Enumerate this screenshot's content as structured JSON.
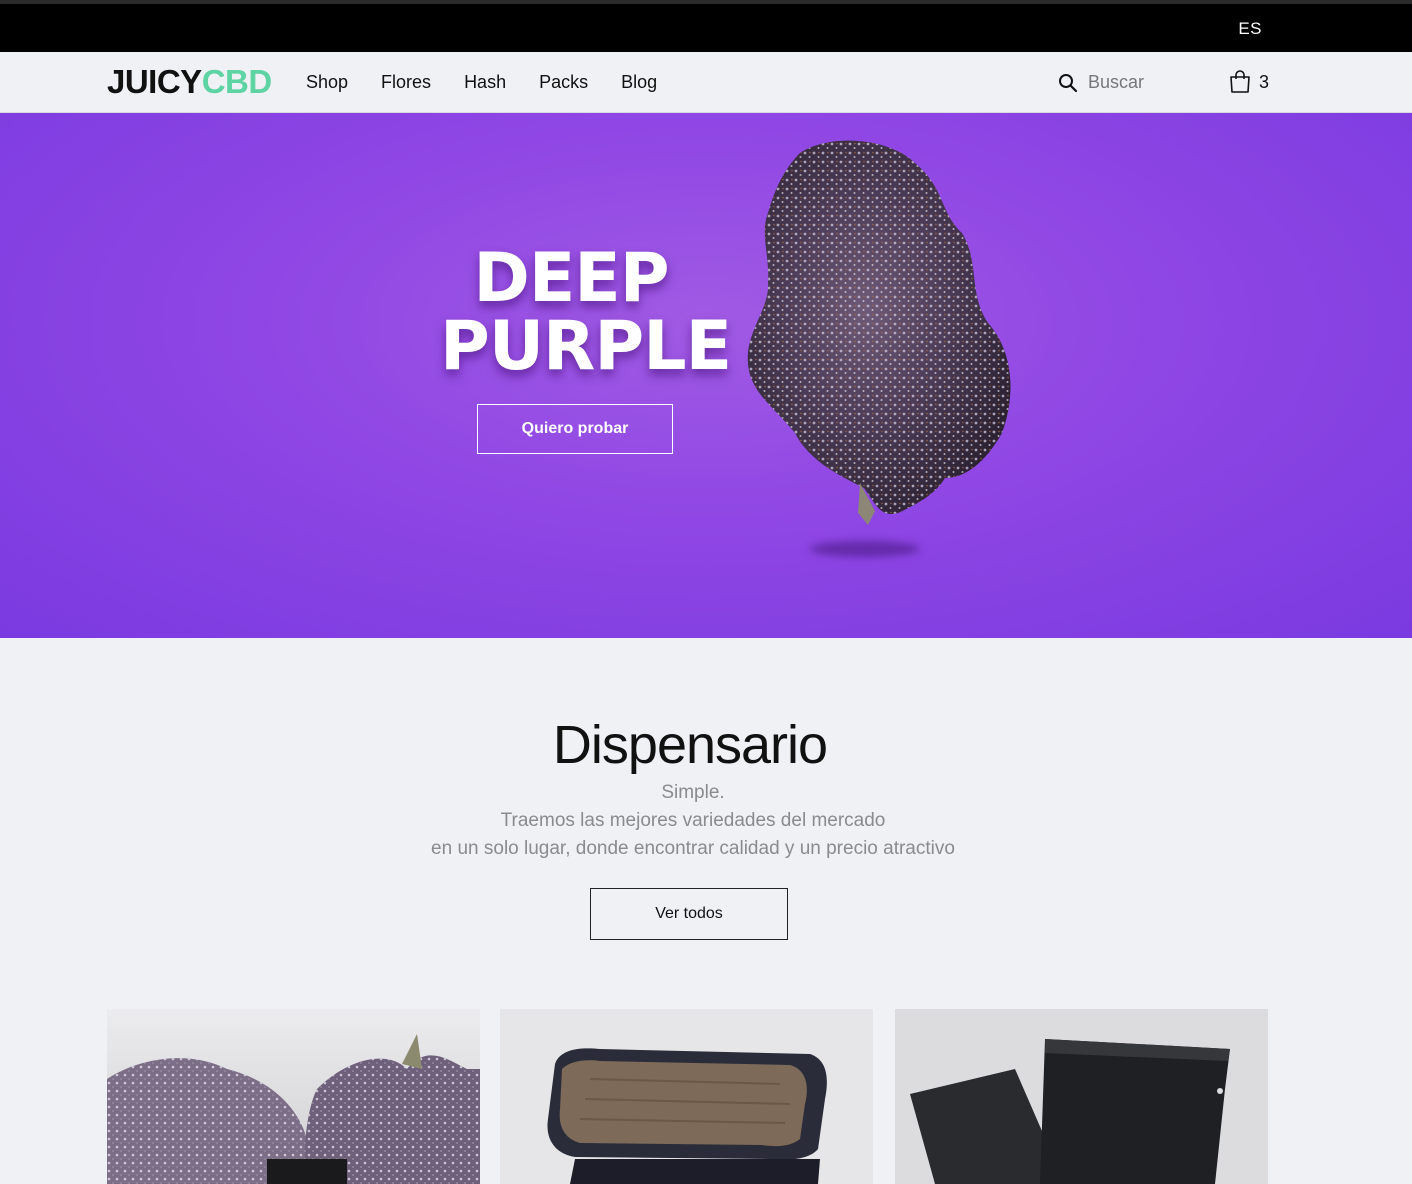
{
  "topbar": {
    "language": "ES"
  },
  "header": {
    "logo": {
      "part1": "JUICY",
      "part2": "CBD"
    },
    "nav": [
      {
        "label": "Shop"
      },
      {
        "label": "Flores"
      },
      {
        "label": "Hash"
      },
      {
        "label": "Packs"
      },
      {
        "label": "Blog"
      }
    ],
    "search": {
      "placeholder": "Buscar",
      "icon": "search-icon"
    },
    "cart": {
      "count": "3",
      "icon": "shopping-bag-icon"
    }
  },
  "hero": {
    "title_line1": "DEEP",
    "title_line2": "PURPLE",
    "cta_label": "Quiero probar",
    "background_color": "#8f46e4"
  },
  "dispensary": {
    "title": "Dispensario",
    "line1": "Simple.",
    "line2": "Traemos las mejores variedades del mercado",
    "line3": "en un solo lugar, donde encontrar calidad y un precio atractivo",
    "cta_label": "Ver todos"
  },
  "products": [
    {
      "image": "flower-buds-image"
    },
    {
      "image": "hash-block-image"
    },
    {
      "image": "black-pouch-image"
    }
  ],
  "colors": {
    "brand_green": "#5ed3a3",
    "topbar": "#000000",
    "page_bg": "#f0f1f5"
  }
}
